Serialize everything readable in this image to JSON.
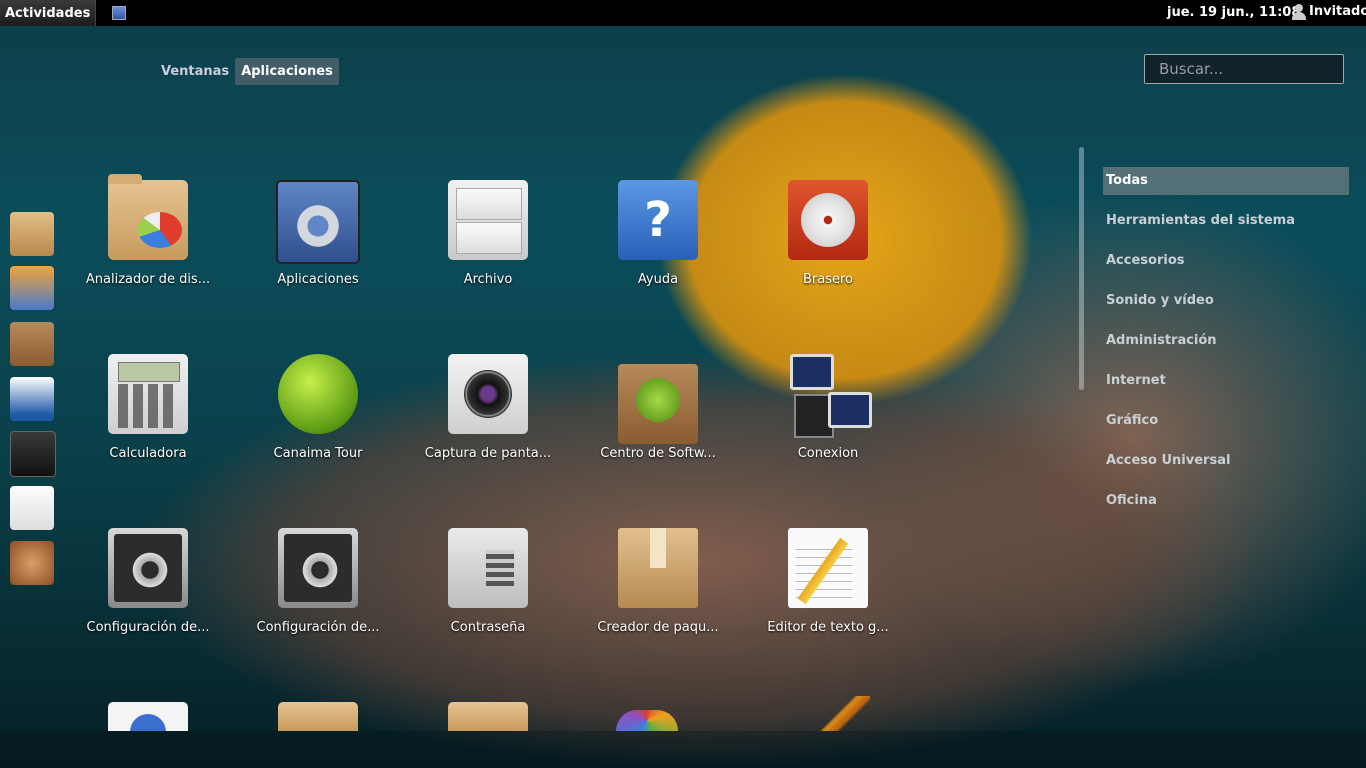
{
  "topbar": {
    "activities": "Actividades",
    "clock": "jue. 19 jun., 11:08",
    "user": "Invitado"
  },
  "view_tabs": [
    {
      "label": "Ventanas",
      "active": false
    },
    {
      "label": "Aplicaciones",
      "active": true
    }
  ],
  "search": {
    "placeholder": "Buscar..."
  },
  "dash": [
    {
      "name": "home-folder-icon"
    },
    {
      "name": "gimp-icon"
    },
    {
      "name": "software-center-icon"
    },
    {
      "name": "writer-icon"
    },
    {
      "name": "terminal-icon"
    },
    {
      "name": "text-editor-icon"
    },
    {
      "name": "speaker-icon"
    }
  ],
  "apps": [
    {
      "label": "Analizador de dis...",
      "icon": "disk-usage-icon"
    },
    {
      "label": "Aplicaciones",
      "icon": "settings-gear-icon"
    },
    {
      "label": "Archivo",
      "icon": "file-cabinet-icon"
    },
    {
      "label": "Ayuda",
      "icon": "help-icon"
    },
    {
      "label": "Brasero",
      "icon": "disc-burner-icon"
    },
    {
      "label": "Calculadora",
      "icon": "calculator-icon"
    },
    {
      "label": "Canaima Tour",
      "icon": "canaima-tour-icon"
    },
    {
      "label": "Captura de panta...",
      "icon": "camera-icon"
    },
    {
      "label": "Centro de Softw...",
      "icon": "software-bag-icon"
    },
    {
      "label": "Conexion",
      "icon": "network-computers-icon"
    },
    {
      "label": "Configuración de...",
      "icon": "config-gears-icon"
    },
    {
      "label": "Configuración de...",
      "icon": "config-gears-icon"
    },
    {
      "label": "Contraseña",
      "icon": "safe-icon"
    },
    {
      "label": "Creador de paqu...",
      "icon": "package-box-icon"
    },
    {
      "label": "Editor de texto g...",
      "icon": "text-editor-icon"
    }
  ],
  "categories": [
    {
      "label": "Todas",
      "active": true
    },
    {
      "label": "Herramientas del sistema"
    },
    {
      "label": "Accesorios"
    },
    {
      "label": "Sonido y vídeo"
    },
    {
      "label": "Administración"
    },
    {
      "label": "Internet"
    },
    {
      "label": "Gráfico"
    },
    {
      "label": "Acceso Universal"
    },
    {
      "label": "Oficina"
    }
  ]
}
